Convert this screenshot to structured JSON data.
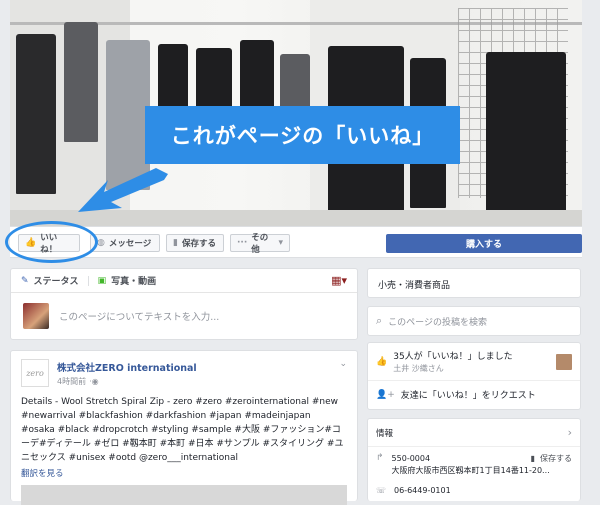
{
  "cover": {
    "callout_text": "これがページの「いいね」"
  },
  "action_bar": {
    "like_label": "いいね！",
    "message_label": "メッセージ",
    "save_label": "保存する",
    "more_label": "その他",
    "buy_label": "購入する"
  },
  "composer": {
    "status_tab": "ステータス",
    "photo_tab": "写真・動画",
    "placeholder": "このページについてテキストを入力..."
  },
  "post": {
    "page_name": "株式会社ZERO international",
    "time": "4時間前",
    "body": "Details - Wool Stretch Spiral Zip - zero #zero #zerointernational #new #newarrival #blackfashion #darkfashion #japan #madeinjapan #osaka #black #dropcrotch #styling #sample #大阪 #ファッション#コーデ#ディテール #ゼロ #靱本町 #本町 #日本 #サンプル #スタイリング #ユニセックス #unisex #ootd @zero___international",
    "see_translation": "翻訳を見る"
  },
  "sidebar": {
    "category": "小売・消費者商品",
    "search_placeholder": "このページの投稿を検索",
    "likes_text": "35人が「いいね！」しました",
    "likes_friend": "土井 沙織さん",
    "invite_text": "友達に「いいね！」をリクエスト",
    "info_title": "情報",
    "postal": "550-0004",
    "address": "大阪府大阪市西区靱本町1丁目14番11-20...",
    "save_label": "保存する",
    "phone": "06-6449-0101"
  },
  "colors": {
    "fb_blue": "#4267b2",
    "callout_blue": "#2e8de6",
    "background": "#e9ebee"
  }
}
